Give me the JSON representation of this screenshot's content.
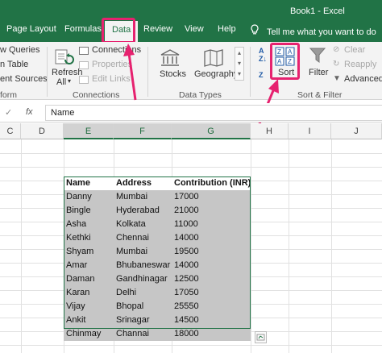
{
  "window": {
    "title": "Book1  -  Excel"
  },
  "tabs": [
    "Page Layout",
    "Formulas",
    "Data",
    "Review",
    "View",
    "Help"
  ],
  "active_tab": "Data",
  "tell_me": "Tell me what you want to do",
  "ribbon": {
    "get_transform": [
      "w Queries",
      "n Table",
      "ent Sources"
    ],
    "get_transform_label": "form",
    "refresh": {
      "line1": "Refresh",
      "line2": "All"
    },
    "connections": {
      "items": [
        "Connections",
        "Properties",
        "Edit Links"
      ],
      "label": "Connections"
    },
    "data_types": {
      "items": [
        "Stocks",
        "Geography"
      ],
      "label": "Data Types"
    },
    "sort_filter": {
      "sort": "Sort",
      "filter": "Filter",
      "clear": "Clear",
      "reapply": "Reapply",
      "advanced": "Advanced",
      "label": "Sort & Filter"
    }
  },
  "formula_bar": {
    "x": "✓",
    "fx": "fx",
    "content": "Name"
  },
  "columns": [
    "C",
    "D",
    "E",
    "F",
    "G",
    "H",
    "I",
    "J"
  ],
  "selected_columns": [
    "E",
    "F",
    "G"
  ],
  "table": {
    "headers": [
      "Name",
      "Address",
      "Contribution (INR)"
    ],
    "rows": [
      [
        "Danny",
        "Mumbai",
        "17000"
      ],
      [
        "Bingle",
        "Hyderabad",
        "21000"
      ],
      [
        "Asha",
        "Kolkata",
        "11000"
      ],
      [
        "Kethki",
        "Chennai",
        "14000"
      ],
      [
        "Shyam",
        "Mumbai",
        "19500"
      ],
      [
        "Amar",
        "Bhubaneswar",
        "14000"
      ],
      [
        "Daman",
        "Gandhinagar",
        "12500"
      ],
      [
        "Karan",
        "Delhi",
        "17050"
      ],
      [
        "Vijay",
        "Bhopal",
        "25550"
      ],
      [
        "Ankit",
        "Srinagar",
        "14500"
      ],
      [
        "Chinmay",
        "Channai",
        "18000"
      ]
    ]
  },
  "colors": {
    "excel_green": "#217346",
    "highlight": "#e6226f",
    "selection_fill": "#c6c6c6"
  }
}
